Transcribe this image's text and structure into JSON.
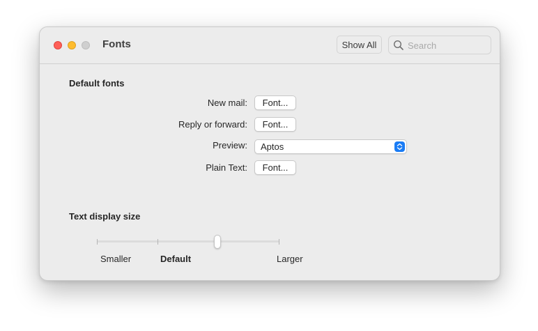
{
  "window": {
    "title": "Fonts",
    "show_all_label": "Show All",
    "search_placeholder": "Search"
  },
  "default_fonts": {
    "heading": "Default fonts",
    "rows": [
      {
        "label": "New mail:",
        "button": "Font..."
      },
      {
        "label": "Reply or forward:",
        "button": "Font..."
      },
      {
        "label": "Preview:",
        "selected": "Aptos"
      },
      {
        "label": "Plain Text:",
        "button": "Font..."
      }
    ]
  },
  "text_size": {
    "heading": "Text display size",
    "labels": [
      "Smaller",
      "Default",
      "Larger"
    ],
    "steps": 4,
    "selected_step": 3
  },
  "colors": {
    "accent": "#1a7cf5",
    "close": "#fe5f57",
    "minimize": "#febc2e",
    "zoom": "#cfcfcf"
  }
}
